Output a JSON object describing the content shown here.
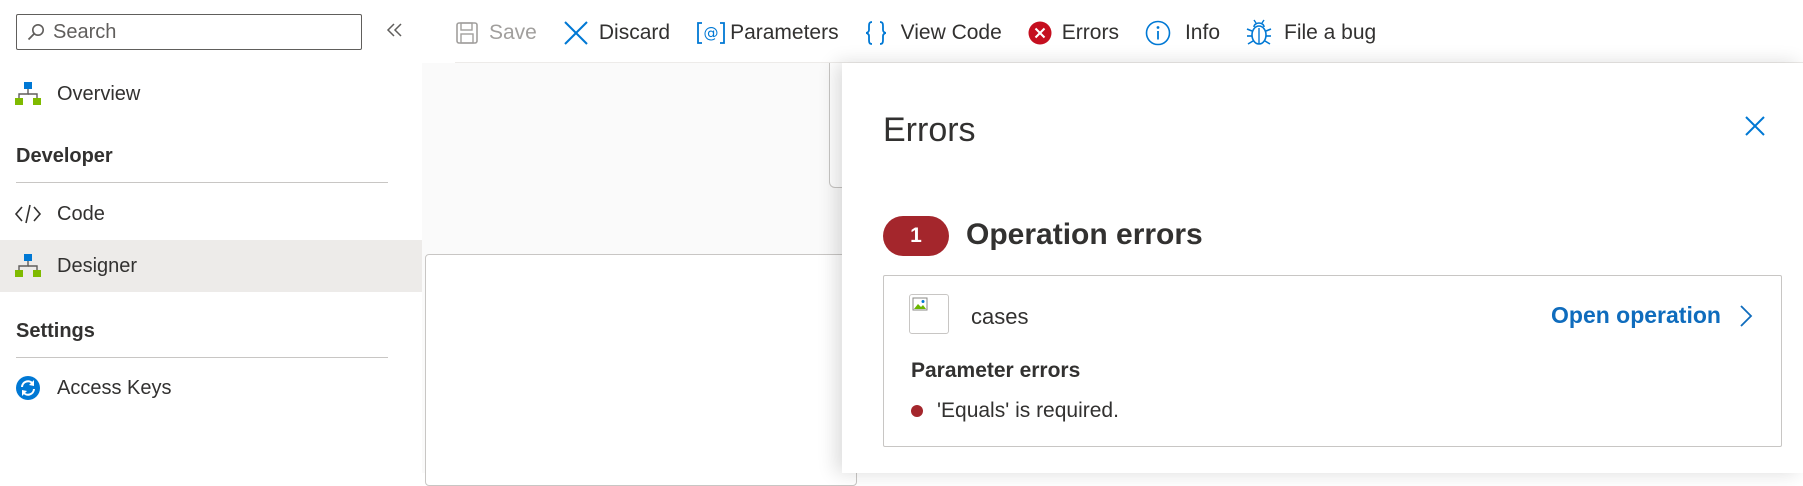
{
  "sidebar": {
    "search_placeholder": "Search",
    "items": [
      {
        "label": "Overview",
        "icon": "overview-icon"
      },
      {
        "label": "Code",
        "icon": "code-icon"
      },
      {
        "label": "Designer",
        "icon": "designer-icon",
        "selected": true
      },
      {
        "label": "Access Keys",
        "icon": "access-keys-icon"
      }
    ],
    "sections": {
      "developer": "Developer",
      "settings": "Settings"
    }
  },
  "toolbar": {
    "save": "Save",
    "discard": "Discard",
    "parameters": "Parameters",
    "view_code": "View Code",
    "errors": "Errors",
    "info": "Info",
    "file_bug": "File a bug"
  },
  "errors_panel": {
    "title": "Errors",
    "count": "1",
    "section_title": "Operation errors",
    "operation": {
      "name": "cases",
      "open_label": "Open operation",
      "param_heading": "Parameter errors",
      "errors": [
        "'Equals' is required."
      ]
    }
  },
  "colors": {
    "accent": "#0f6cbd",
    "error": "#a4262c",
    "selected_bg": "#edebe9"
  }
}
